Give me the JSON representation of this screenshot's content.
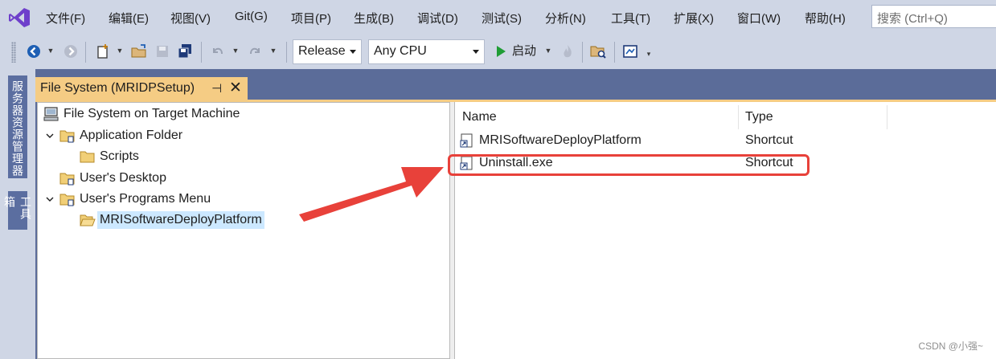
{
  "menubar": {
    "items": [
      "文件(F)",
      "编辑(E)",
      "视图(V)",
      "Git(G)",
      "项目(P)",
      "生成(B)",
      "调试(D)",
      "测试(S)",
      "分析(N)",
      "工具(T)",
      "扩展(X)",
      "窗口(W)",
      "帮助(H)"
    ],
    "search_placeholder": "搜索 (Ctrl+Q)"
  },
  "toolbar": {
    "configuration": "Release",
    "platform": "Any CPU",
    "start_label": "启动",
    "icons": [
      "back-icon",
      "forward-icon",
      "new-item-icon",
      "open-folder-icon",
      "save-icon",
      "save-all-icon",
      "undo-icon",
      "redo-icon",
      "start-icon",
      "hot-reload-icon",
      "explorer-icon",
      "screenshot-icon"
    ]
  },
  "side_rail": {
    "server_explorer": "服务器资源管理器",
    "toolbox": "工具箱"
  },
  "document_tab": {
    "title": "File System (MRIDPSetup)",
    "pin": "⊣",
    "close": "✕"
  },
  "tree": {
    "root": "File System on Target Machine",
    "application_folder": "Application Folder",
    "scripts": "Scripts",
    "users_desktop": "User's Desktop",
    "users_programs_menu": "User's Programs Menu",
    "mri_platform": "MRISoftwareDeployPlatform"
  },
  "list": {
    "columns": {
      "name": "Name",
      "type": "Type"
    },
    "rows": [
      {
        "name": "MRISoftwareDeployPlatform",
        "type": "Shortcut"
      },
      {
        "name": "Uninstall.exe",
        "type": "Shortcut"
      }
    ]
  },
  "colors": {
    "menu_bg": "#cfd6e5",
    "doc_bg": "#5b6c99",
    "tab_active": "#f5cc84",
    "selection": "#cce8ff",
    "annotation": "#e8413a"
  },
  "watermark": "CSDN @小强~"
}
